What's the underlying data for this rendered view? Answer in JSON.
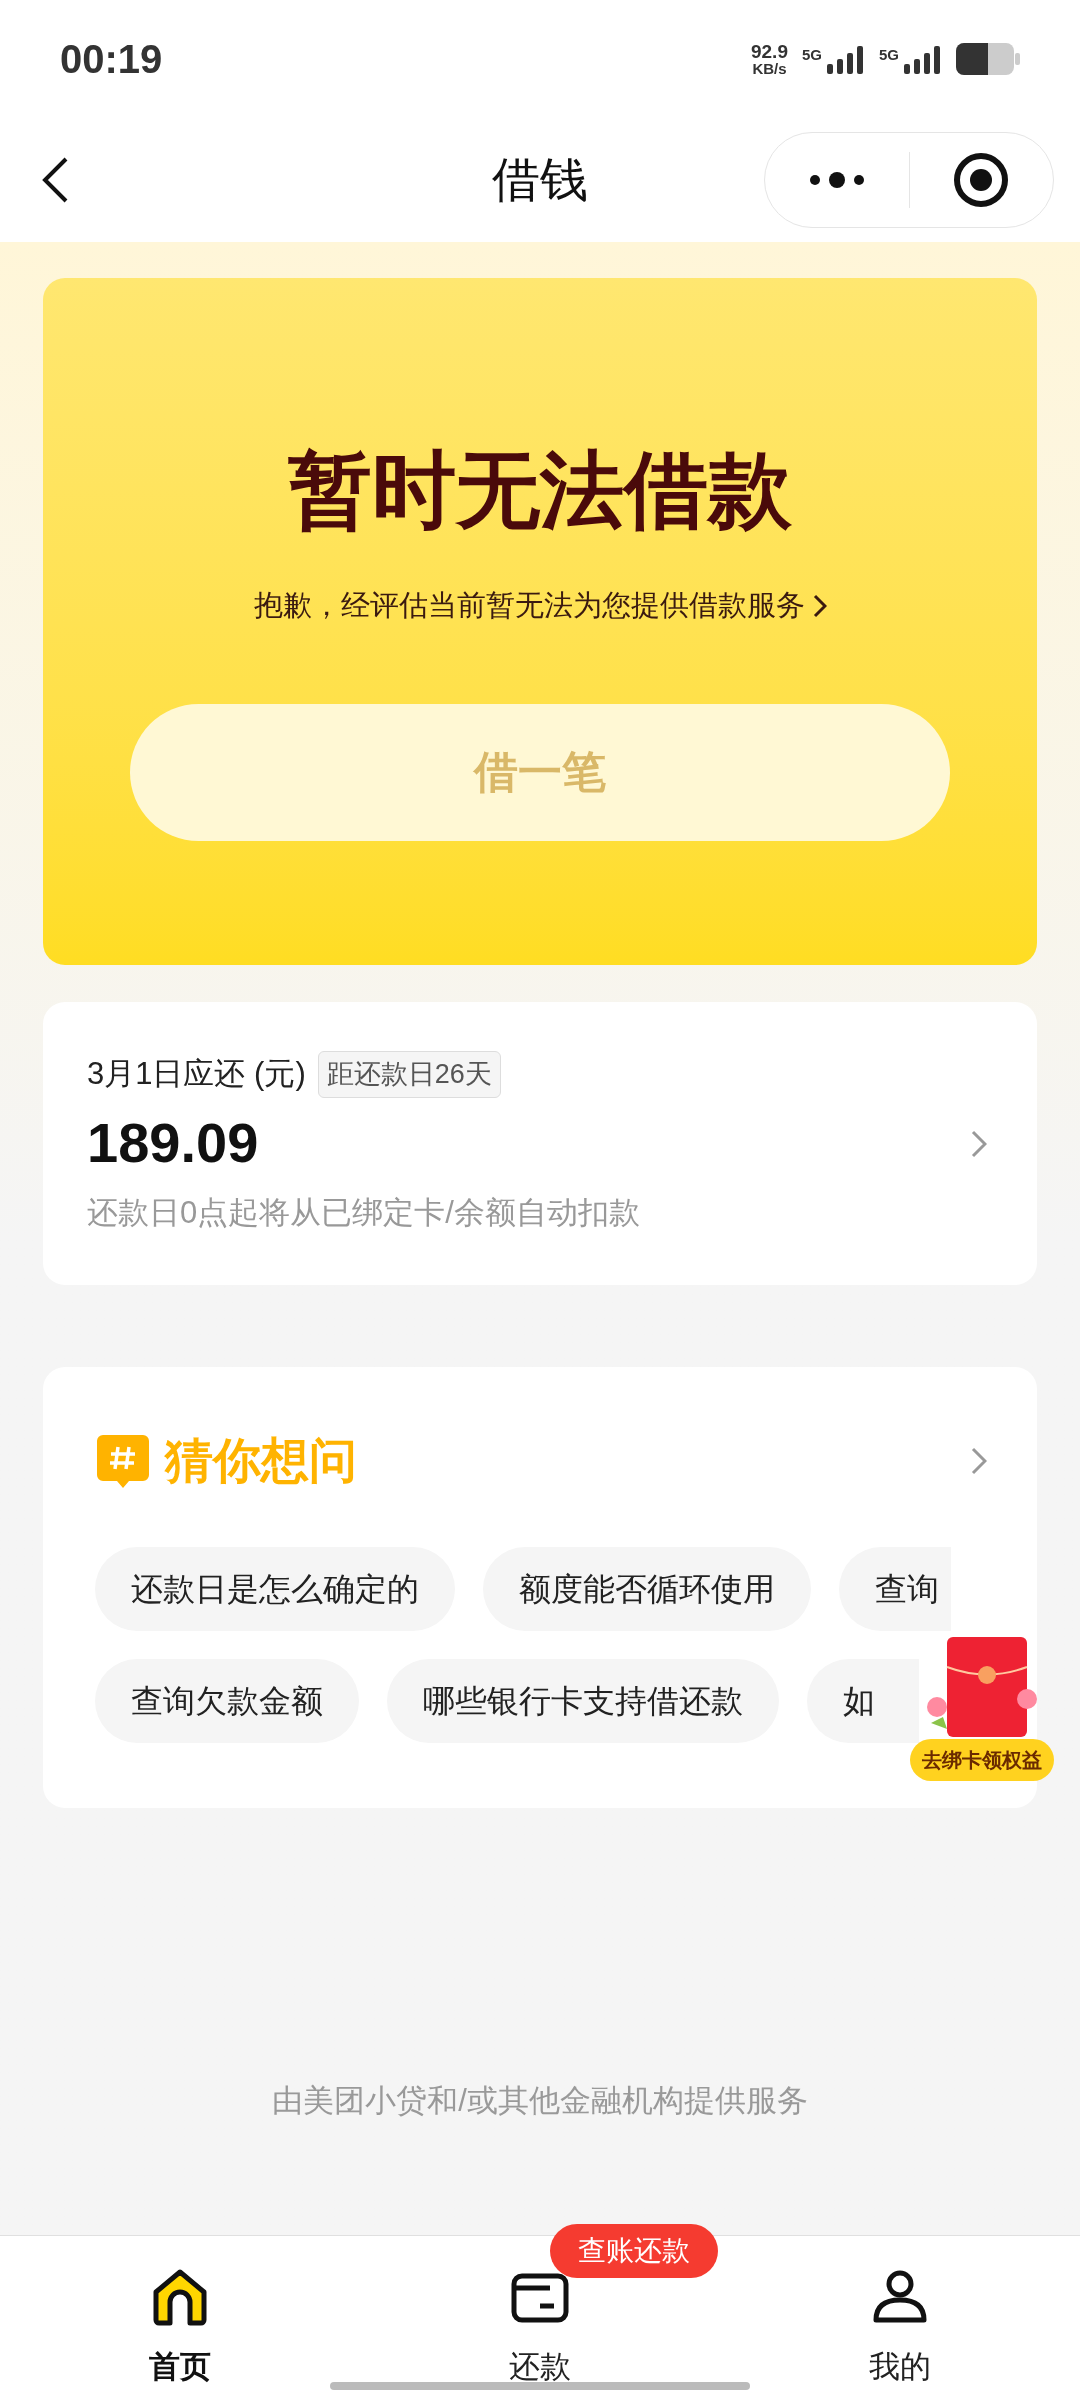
{
  "status_bar": {
    "time": "00:19",
    "net_speed": "92.9",
    "net_unit": "KB/s",
    "sim_1": "5G",
    "sim_2": "5G"
  },
  "nav_bar": {
    "title": "借钱"
  },
  "hero": {
    "title": "暂时无法借款",
    "subtitle": "抱歉，经评估当前暂无法为您提供借款服务",
    "button": {
      "label": "借一笔",
      "disabled": true
    }
  },
  "repayment": {
    "label": "3月1日应还 (元)",
    "tag": "距还款日26天",
    "amount": "189.09",
    "note": "还款日0点起将从已绑定卡/余额自动扣款"
  },
  "faq": {
    "title": "猜你想问",
    "rows": [
      [
        "还款日是怎么确定的",
        "额度能否循环使用",
        "查询"
      ],
      [
        "查询欠款金额",
        "哪些银行卡支持借还款",
        "如"
      ]
    ]
  },
  "promo": {
    "label": "去绑卡领权益"
  },
  "footer": "由美团小贷和/或其他金融机构提供服务",
  "tabs": [
    {
      "label": "首页",
      "kind": "home",
      "selected": true
    },
    {
      "label": "还款",
      "kind": "repay",
      "selected": false,
      "badge": "查账还款"
    },
    {
      "label": "我的",
      "kind": "me",
      "selected": false
    }
  ]
}
